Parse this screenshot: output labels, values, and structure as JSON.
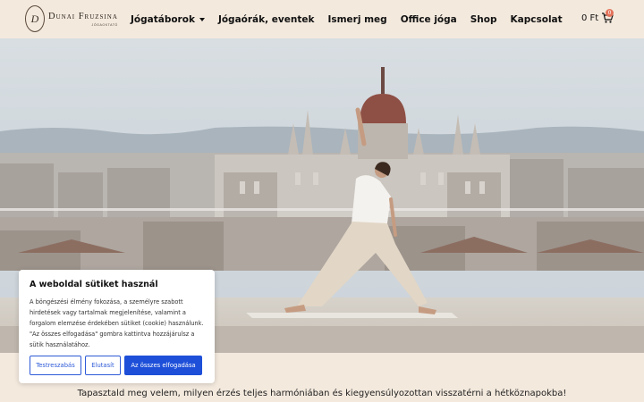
{
  "logo": {
    "monogram": "D",
    "name": "Dunai Fruzsina",
    "subtitle": "JÓGAOKTATÓ"
  },
  "nav": {
    "items": [
      {
        "label": "Jógatáborok",
        "has_dropdown": true
      },
      {
        "label": "Jógaórák, eventek"
      },
      {
        "label": "Ismerj meg"
      },
      {
        "label": "Office jóga"
      },
      {
        "label": "Shop"
      },
      {
        "label": "Kapcsolat"
      }
    ]
  },
  "cart": {
    "total": "0 Ft",
    "count": "0",
    "badge_color": "#e3725a"
  },
  "hero": {
    "tagline": "Tapasztald meg velem, milyen érzés teljes harmóniában és kiegyensúlyozottan visszatérni a hétköznapokba!"
  },
  "cookie": {
    "title": "A weboldal sütiket használ",
    "text": "A böngészési élmény fokozása, a személyre szabott hirdetések vagy tartalmak megjelenítése, valamint a forgalom elemzése érdekében sütiket (cookie) használunk.  \"Az összes elfogadása\" gombra kattintva hozzájárulsz a sütik használatához.",
    "buttons": {
      "customize": "Testreszabás",
      "reject": "Elutasít",
      "accept_all": "Az összes elfogadása"
    },
    "accent_color": "#1d4fd9"
  },
  "colors": {
    "background": "#f3e9dd"
  }
}
